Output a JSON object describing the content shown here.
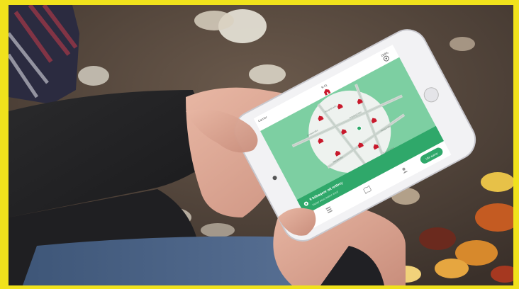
{
  "photo": {
    "border_color": "#f0e21c",
    "subject": "hands holding smartphone over autumn leaves"
  },
  "app": {
    "brand_color": "#2fa86a",
    "pin_color": "#c8192c",
    "carrier": "Carrier",
    "time": "9:41",
    "battery": "100%",
    "banner_title": "9 bitbaqenr oit nrtlevy",
    "banner_sub": "Ioqrgr aouu biamr enuf",
    "action_button": "Ubr aueoy",
    "streets": [
      "Anobstraße",
      "Friedastraße",
      "Mariahilfer",
      "Feldstraße",
      "Hauptstraße",
      "Sonnenweg"
    ]
  },
  "icons": [
    "home-pin-icon",
    "gear-icon",
    "location-pin-icon",
    "list-icon",
    "map-icon",
    "profile-icon"
  ]
}
